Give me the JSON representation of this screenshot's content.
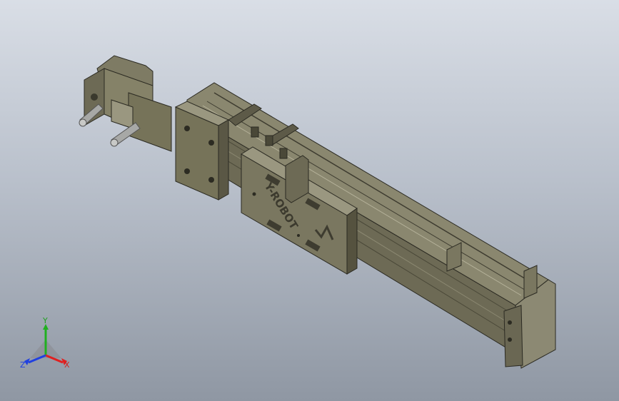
{
  "viewport": {
    "background_top": "#d9dee6",
    "background_bottom": "#8f97a3"
  },
  "model": {
    "part_color": "#79765f",
    "part_dark": "#4f4c3c",
    "part_light": "#9a9780",
    "plate_logo_text": "Y-ROBOT",
    "parts": [
      "motor-block",
      "knob-left",
      "knob-right",
      "rail-body",
      "carriage-plate",
      "end-cap"
    ]
  },
  "triad": {
    "x_label": "X",
    "y_label": "Y",
    "z_label": "Z",
    "x_color": "#e02020",
    "y_color": "#20b020",
    "z_color": "#2040e0"
  }
}
